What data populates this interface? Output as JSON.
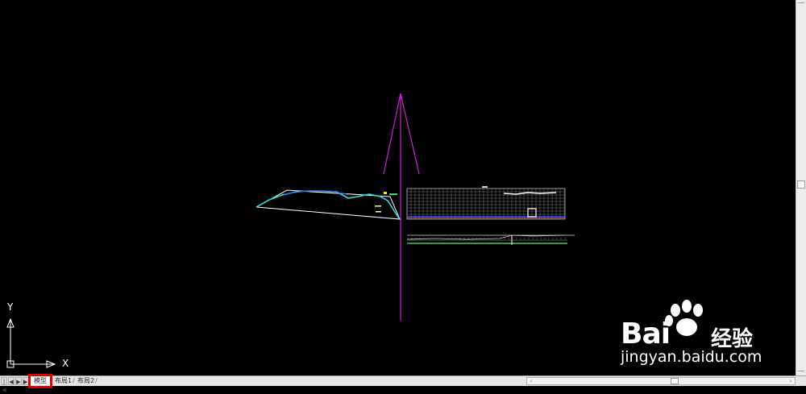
{
  "ucs": {
    "y_label": "Y",
    "x_label": "X"
  },
  "tabs": [
    {
      "label": "模型",
      "active": true
    },
    {
      "label": "布局1",
      "active": false
    },
    {
      "label": "布局2",
      "active": false
    }
  ],
  "nav_buttons": [
    "|◀",
    "◀",
    "▶",
    "▶|"
  ],
  "watermark": {
    "brand": "Bai",
    "cn": "经验",
    "url": "jingyan.baidu.com"
  },
  "colors": {
    "background": "#000000",
    "magenta": "#d21ed2",
    "cyan": "#20e0e0",
    "highlight": "#e00000"
  }
}
